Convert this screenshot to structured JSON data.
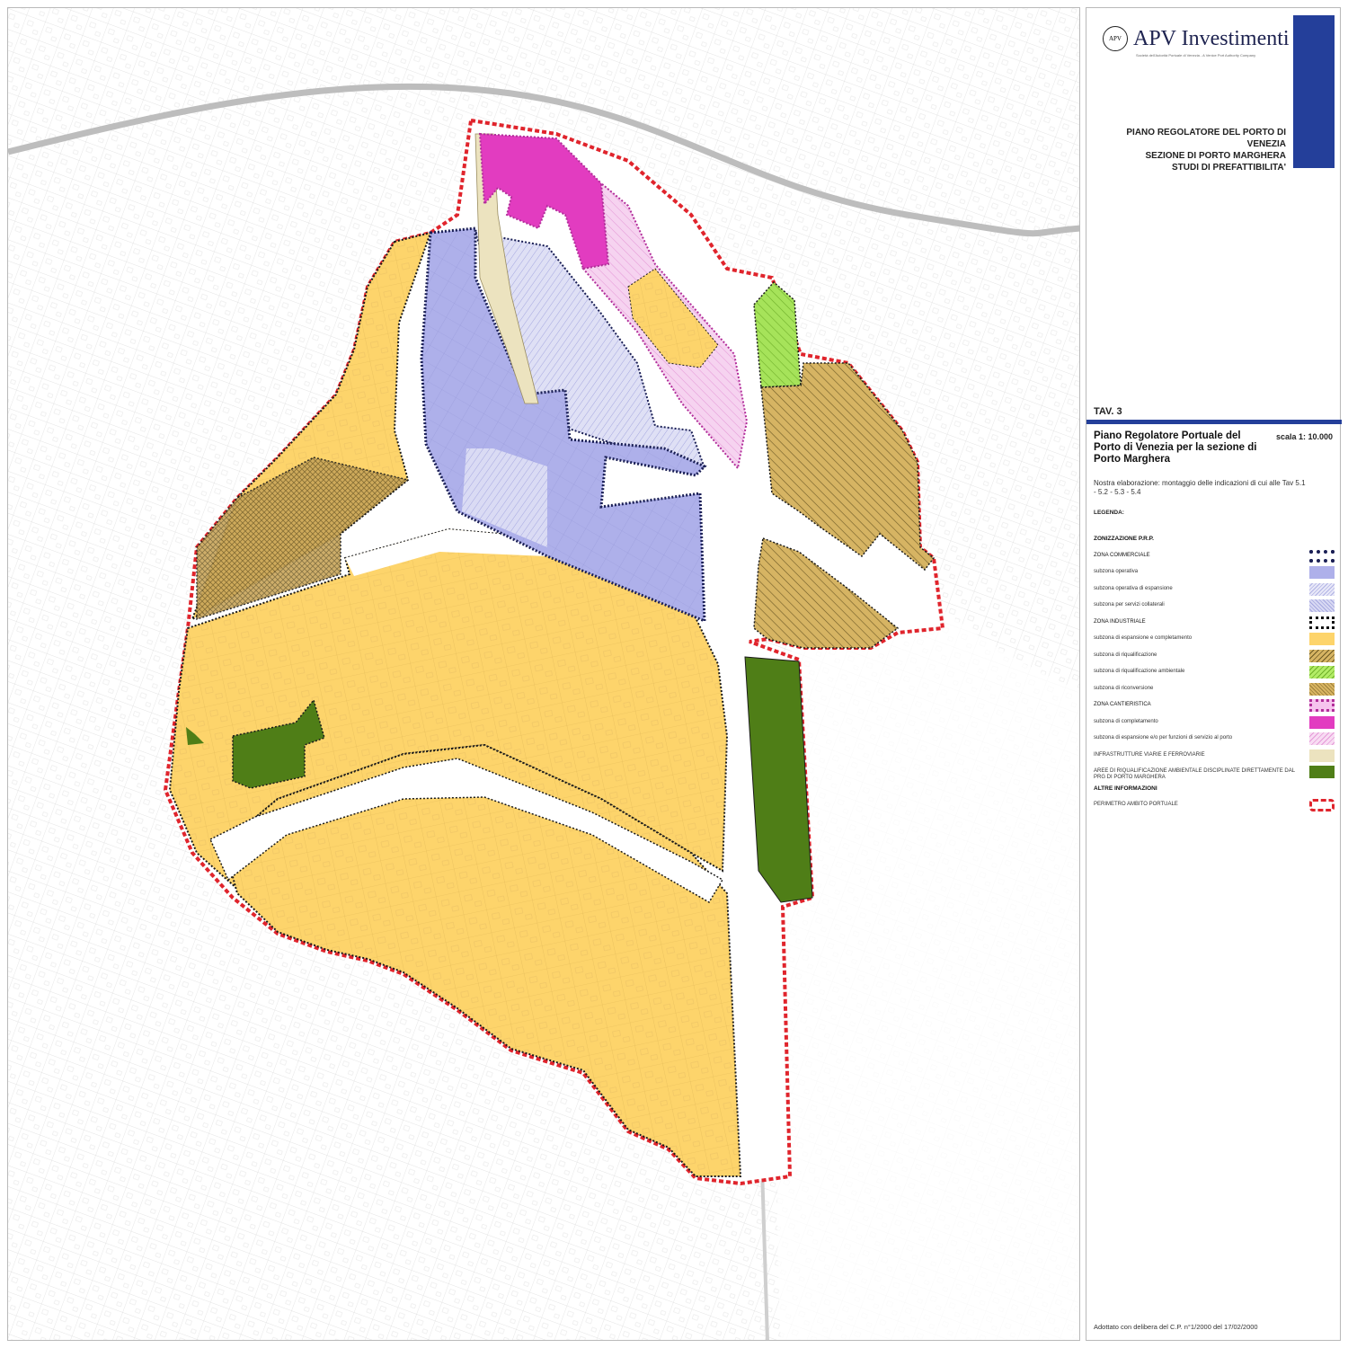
{
  "header": {
    "brand": "APV Investimenti",
    "tagline": "Società dell'Autorità Portuale di Venezia - A Venice Port Authority Company",
    "titles": [
      "PIANO REGOLATORE DEL PORTO DI VENEZIA",
      "SEZIONE DI PORTO MARGHERA",
      "STUDI DI PREFATTIBILITA'"
    ],
    "accent_color": "#243f9a"
  },
  "sheet": {
    "tav": "TAV. 3",
    "title": "Piano Regolatore Portuale del Porto di Venezia per la sezione di Porto Marghera",
    "scale": "scala 1: 10.000",
    "subtitle": "Nostra elaborazione: montaggio delle indicazioni di cui alle Tav 5.1 - 5.2 - 5.3 - 5.4",
    "legend_title": "LEGENDA:",
    "footer": "Adottato con delibera del C.P. n°1/2000 del 17/02/2000"
  },
  "legend": [
    {
      "label": "ZONIZZAZIONE P.R.P.",
      "kind": "head",
      "swatch": "none"
    },
    {
      "label": "ZONA COMMERCIALE",
      "kind": "zone",
      "swatch": "dots-navy"
    },
    {
      "label": "subzona operativa",
      "kind": "item",
      "swatch": "fill-periwinkle"
    },
    {
      "label": "subzona operativa di espansione",
      "kind": "item",
      "swatch": "hatch-lavender"
    },
    {
      "label": "subzona per servizi collaterali",
      "kind": "item",
      "swatch": "cross-lavender"
    },
    {
      "label": "ZONA INDUSTRIALE",
      "kind": "zone",
      "swatch": "dots-black"
    },
    {
      "label": "subzona di espansione e completamento",
      "kind": "item",
      "swatch": "fill-yellow"
    },
    {
      "label": "subzona di riqualificazione",
      "kind": "item",
      "swatch": "hatch-olive"
    },
    {
      "label": "subzona di riqualificazione ambientale",
      "kind": "item",
      "swatch": "hatch-green"
    },
    {
      "label": "subzona di riconversione",
      "kind": "item",
      "swatch": "cross-olive"
    },
    {
      "label": "ZONA CANTIERISTICA",
      "kind": "zone",
      "swatch": "dots-magenta"
    },
    {
      "label": "subzona di completamento",
      "kind": "item",
      "swatch": "fill-magenta"
    },
    {
      "label": "subzona di espansione e/o per funzioni di servizio al porto",
      "kind": "item",
      "swatch": "hatch-pink"
    },
    {
      "label": "INFRASTRUTTURE VIARIE E FERROVIARIE",
      "kind": "item",
      "swatch": "fill-beige"
    },
    {
      "label": "AREE DI RIQUALIFICAZIONE AMBIENTALE DISCIPLINATE DIRETTAMENTE DAL PRG DI PORTO MARGHERA",
      "kind": "item",
      "swatch": "fill-darkgreen"
    },
    {
      "label": "ALTRE INFORMAZIONI",
      "kind": "head",
      "swatch": "none"
    },
    {
      "label": "PERIMETRO AMBITO PORTUALE",
      "kind": "item",
      "swatch": "dash-red"
    }
  ],
  "colors": {
    "industrial_yellow": "#fdd46b",
    "operativa": "#aeb0ea",
    "espansione": "#d6d8f2",
    "riconversione": "#d9b562",
    "riqualificazione": "#c5a052",
    "ambientale_green": "#a6e35a",
    "dark_green": "#4f7e17",
    "magenta": "#e23cc0",
    "pink": "#f4c6ee",
    "beige": "#ece3bf",
    "perimeter_red": "#e0242c",
    "navy": "#1a1f55"
  }
}
